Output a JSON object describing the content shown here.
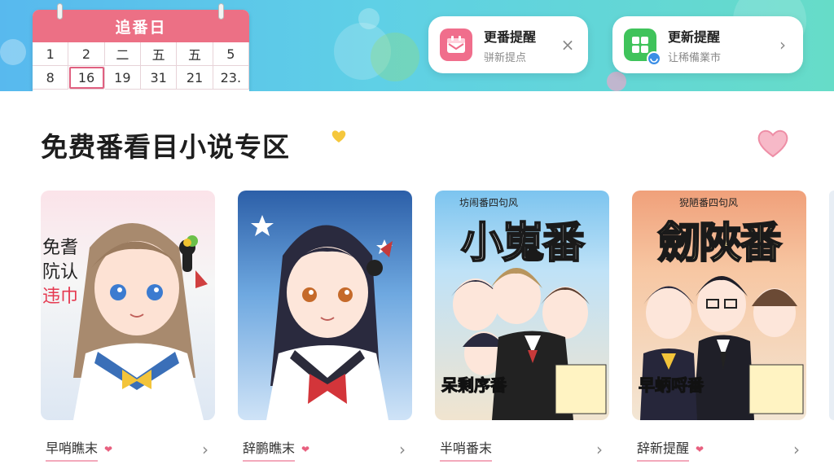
{
  "header": {
    "calendar": {
      "title": "追番日",
      "days_row1": [
        "1",
        "2",
        "二",
        "五",
        "五",
        "5"
      ],
      "days_row2": [
        "8",
        "16",
        "19",
        "31",
        "21",
        "23."
      ]
    },
    "reminder_cards": [
      {
        "title": "更番提醒",
        "subtitle": "骈新提点",
        "action": "×",
        "icon": "calendar-mail-icon"
      },
      {
        "title": "更新提醒",
        "subtitle": "让稀備業市",
        "action": "›",
        "icon": "app-grid-icon"
      }
    ]
  },
  "section": {
    "title": "免费番看目小说专区"
  },
  "cards": [
    {
      "label": "早哨瞧末",
      "cover_side_text": [
        "免耆",
        "阬认",
        "违巾"
      ],
      "cover_title": "",
      "cover_bottom": "",
      "cover_small": ""
    },
    {
      "label": "辞鹏瞧末",
      "cover_side_text": [],
      "cover_title": "",
      "cover_bottom": "",
      "cover_small": ""
    },
    {
      "label": "半哨番末",
      "cover_side_text": [],
      "cover_title": "小嵬番",
      "cover_bottom": "呆剩序番",
      "cover_small": "坊闹番四句风"
    },
    {
      "label": "辞新提醒",
      "cover_side_text": [],
      "cover_title": "劒陜番",
      "cover_bottom": "早蛃哷番",
      "cover_small": "猊陋番四句风"
    }
  ],
  "colors": {
    "accent_pink": "#ec7085",
    "header_gradient_start": "#58b9ee",
    "header_gradient_end": "#66dcc8",
    "green_icon": "#3fc35b"
  }
}
